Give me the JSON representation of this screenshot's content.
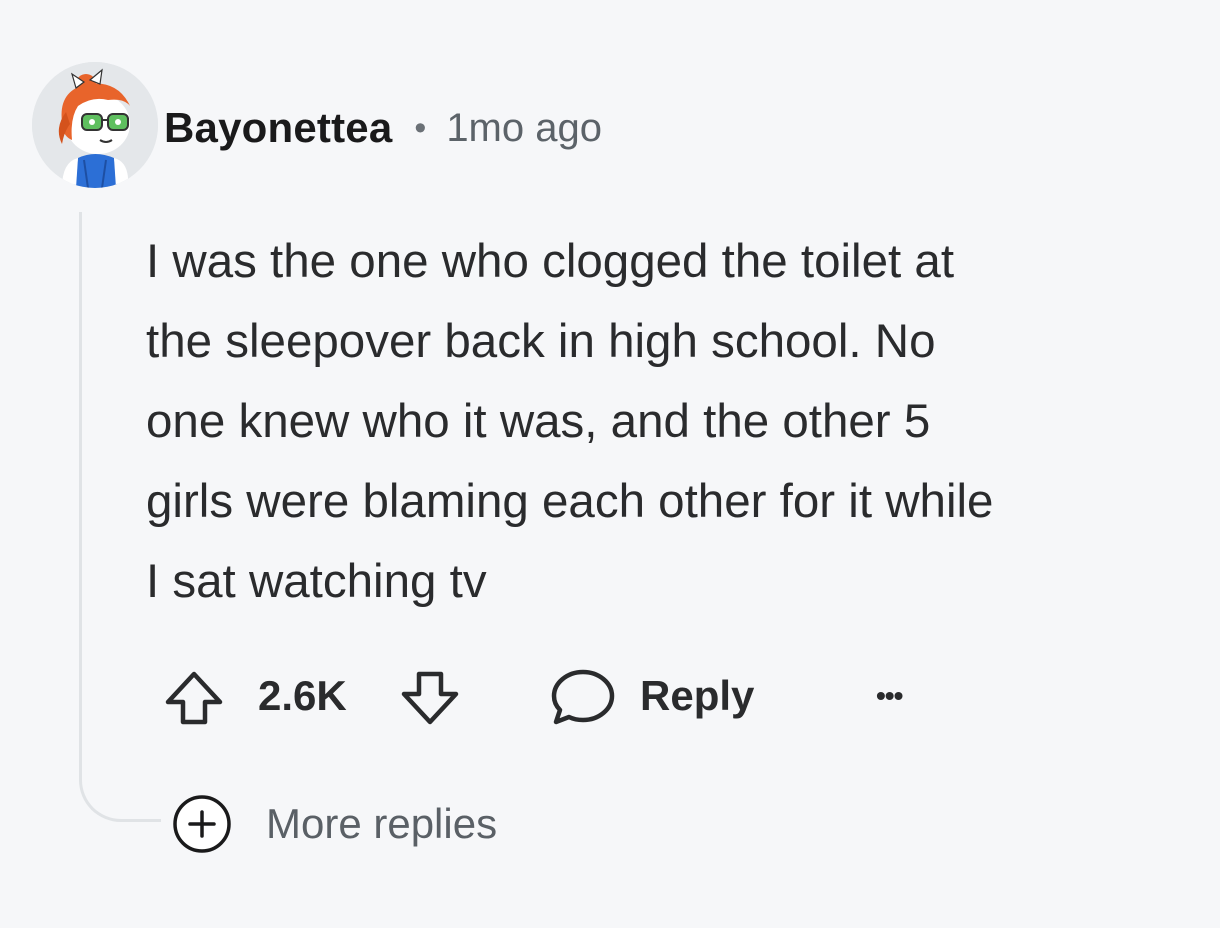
{
  "comment": {
    "author": "Bayonettea",
    "separator": "•",
    "timestamp": "1mo ago",
    "avatar_icon": "avatar-redhead-glasses-icon",
    "body_lines": [
      "I was the one who clogged the toilet at",
      "the sleepover back in high school. No",
      "one knew who it was, and the other 5",
      "girls were blaming each other for it while",
      "I sat watching tv"
    ],
    "score": "2.6K",
    "reply_label": "Reply",
    "more_label": "•••",
    "more_replies_label": "More replies"
  },
  "icons": {
    "upvote": "upvote-arrow-icon",
    "downvote": "downvote-arrow-icon",
    "reply": "speech-bubble-icon",
    "more_replies": "plus-circle-icon"
  },
  "colors": {
    "background": "#f6f7f9",
    "text": "#2a2b2d",
    "muted": "#5c6369",
    "thread_line": "#e0e3e6"
  }
}
